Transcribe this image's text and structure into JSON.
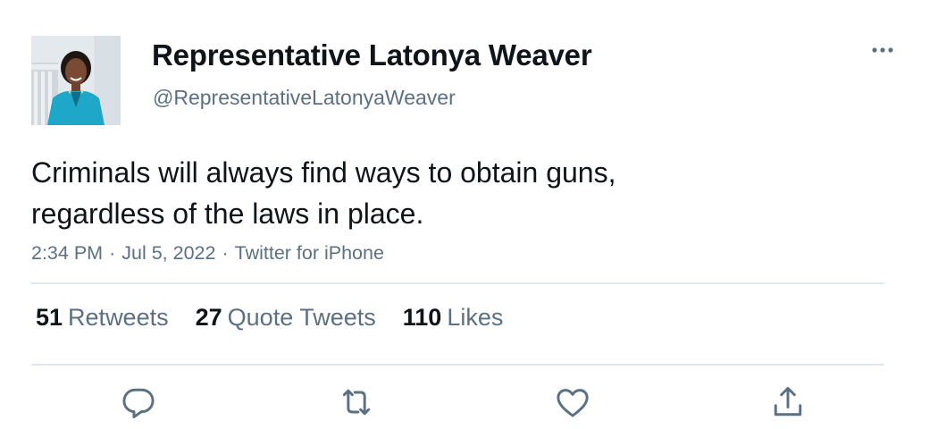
{
  "author": {
    "name": "Representative Latonya Weaver",
    "handle": "@RepresentativeLatonyaWeaver"
  },
  "tweet": {
    "text_lines": [
      "Criminals will always find ways to obtain guns,",
      "regardless of the laws in place."
    ],
    "time": "2:34 PM",
    "date": "Jul 5, 2022",
    "source": "Twitter for iPhone",
    "separator": "·"
  },
  "stats": {
    "retweets": {
      "count": "51",
      "label": "Retweets"
    },
    "quote_tweets": {
      "count": "27",
      "label": "Quote Tweets"
    },
    "likes": {
      "count": "110",
      "label": "Likes"
    }
  },
  "icons": {
    "more": "more-horizontal-icon",
    "reply": "reply-icon",
    "retweet": "retweet-icon",
    "like": "heart-icon",
    "share": "share-icon"
  },
  "colors": {
    "text_primary": "#0f1419",
    "text_secondary": "#5b7083",
    "divider": "#e1e8ed",
    "avatar_jacket": "#1ea7c9"
  }
}
